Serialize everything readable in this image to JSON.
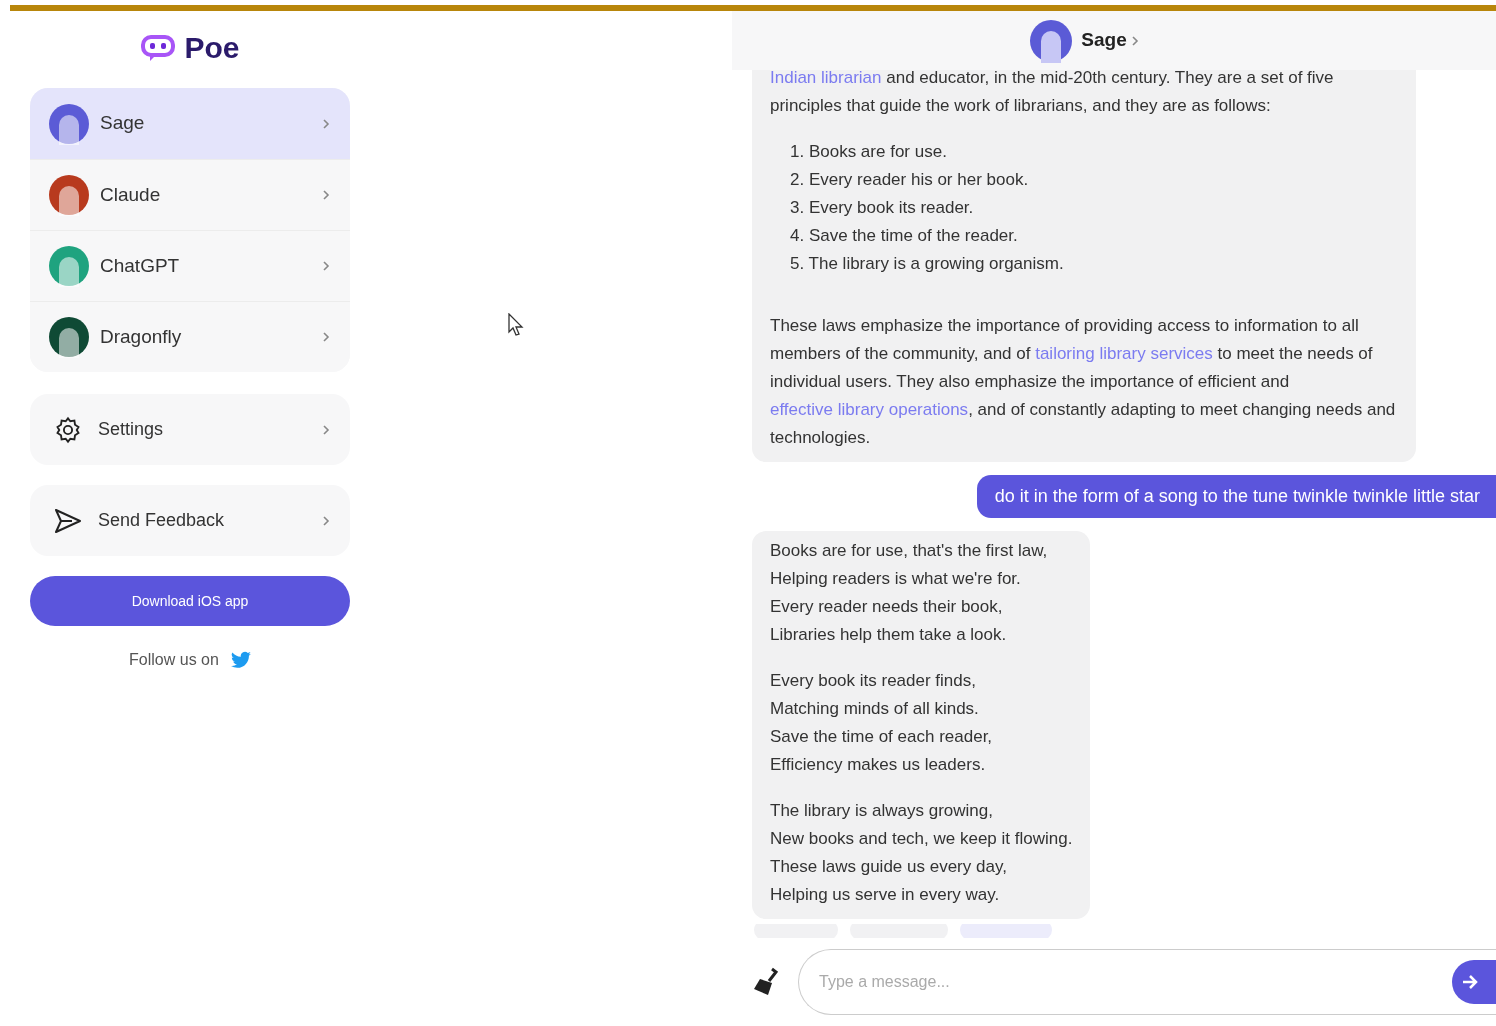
{
  "logo": {
    "text": "Poe"
  },
  "bots": [
    {
      "name": "Sage",
      "color": "#5b5bd6",
      "selected": true
    },
    {
      "name": "Claude",
      "color": "#b83a1e",
      "selected": false
    },
    {
      "name": "ChatGPT",
      "color": "#1fa37f",
      "selected": false
    },
    {
      "name": "Dragonfly",
      "color": "#0f4a35",
      "selected": false
    }
  ],
  "menu": [
    {
      "label": "Settings",
      "kind": "settings"
    },
    {
      "label": "Send Feedback",
      "kind": "feedback"
    }
  ],
  "download_button": "Download iOS app",
  "follow": {
    "text": "Follow us on"
  },
  "chat": {
    "header": {
      "title": "Sage"
    },
    "messages": [
      {
        "kind": "bot",
        "blocks": [
          {
            "kind": "paragraph",
            "segments": [
              {
                "text": "Indian librarian",
                "kind": "link"
              },
              {
                "text": " and educator, in the mid-20th century. They are a set of five principles that guide the work of librarians, and they are as follows:",
                "kind": "plain"
              }
            ]
          },
          {
            "kind": "list",
            "items": [
              "1. Books are for use.",
              "2. Every reader his or her book.",
              "3. Every book its reader.",
              "4. Save the time of the reader.",
              "5. The library is a growing organism."
            ]
          },
          {
            "kind": "paragraph",
            "segments": [
              {
                "text": "These laws emphasize the importance of providing access to information to all members of the community, and of ",
                "kind": "plain"
              },
              {
                "text": "tailoring library services",
                "kind": "link"
              },
              {
                "text": " to meet the needs of individual users. They also emphasize the importance of efficient and ",
                "kind": "plain"
              },
              {
                "text": "effective library operations",
                "kind": "link"
              },
              {
                "text": ", and of constantly adapting to meet changing needs and technologies.",
                "kind": "plain"
              }
            ]
          }
        ]
      },
      {
        "kind": "user",
        "text": "do it in the form of a song to the tune twinkle twinkle little star"
      },
      {
        "kind": "bot",
        "blocks": [
          {
            "kind": "list",
            "items": [
              "Books are for use, that's the first law,",
              "Helping readers is what we're for.",
              "Every reader needs their book,",
              "Libraries help them take a look."
            ]
          },
          {
            "kind": "list",
            "items": [
              "Every book its reader finds,",
              "Matching minds of all kinds.",
              "Save the time of each reader,",
              "Efficiency makes us leaders."
            ]
          },
          {
            "kind": "list",
            "items": [
              "The library is always growing,",
              "New books and tech, we keep it flowing.",
              "These laws guide us every day,",
              "Helping us serve in every way."
            ]
          }
        ]
      }
    ]
  },
  "composer": {
    "placeholder": "Type a message..."
  }
}
